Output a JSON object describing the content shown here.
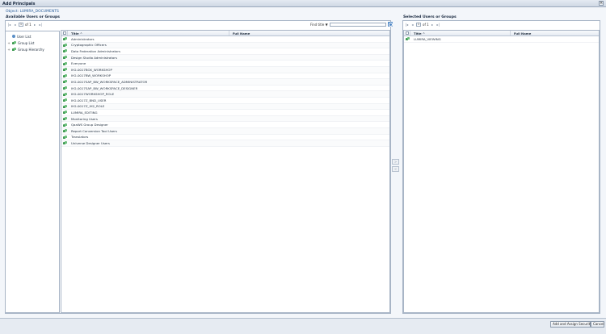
{
  "window": {
    "title": "Add Principals",
    "close_label": "×"
  },
  "object_line": "Object: LUMIRA_DOCUMENTS",
  "available": {
    "title": "Available Users or Groups",
    "pager": {
      "page": "1",
      "of": "of 1"
    },
    "find": {
      "label": "Find title",
      "arrow": "▼",
      "placeholder": ""
    },
    "tree": [
      {
        "label": "User List",
        "icon": "user-icon"
      },
      {
        "label": "Group List",
        "icon": "group-icon"
      },
      {
        "label": "Group Hierarchy",
        "icon": "group-icon"
      }
    ],
    "columns": {
      "title": "Title ^",
      "full_name": "Full Name"
    },
    "rows": [
      "Administrators",
      "Cryptographic Officers",
      "Data Federation Administrators",
      "Design Studio Administrators",
      "Everyone",
      "IH2-0017BOX_WORKSHOP",
      "IH2-0017BW_WORKSHOP",
      "IH2-0017SAP_BW_WORKSPACE_ADMINISTRATOR",
      "IH2-0017SAP_BW_WORKSPACE_DESIGNER",
      "IH2-0017WORKSHOP_ROLE",
      "IH2-0017Z_BND_USER",
      "IH2-0017Z_IH2_ROLE",
      "LUMIRA_EDITING",
      "Monitoring Users",
      "QaaWS Group Designer",
      "Report Conversion Tool Users",
      "Translators",
      "Universe Designer Users"
    ]
  },
  "selected": {
    "title": "Selected Users or Groups",
    "pager": {
      "page": "1",
      "of": "of 1"
    },
    "columns": {
      "title": "Title ^",
      "full_name": "Full Name"
    },
    "rows": [
      "LUMIRA_VIEWING"
    ]
  },
  "arrows": {
    "add": ">",
    "remove": "<"
  },
  "footer": {
    "add_assign": "Add and Assign Security",
    "cancel": "Cancel"
  }
}
